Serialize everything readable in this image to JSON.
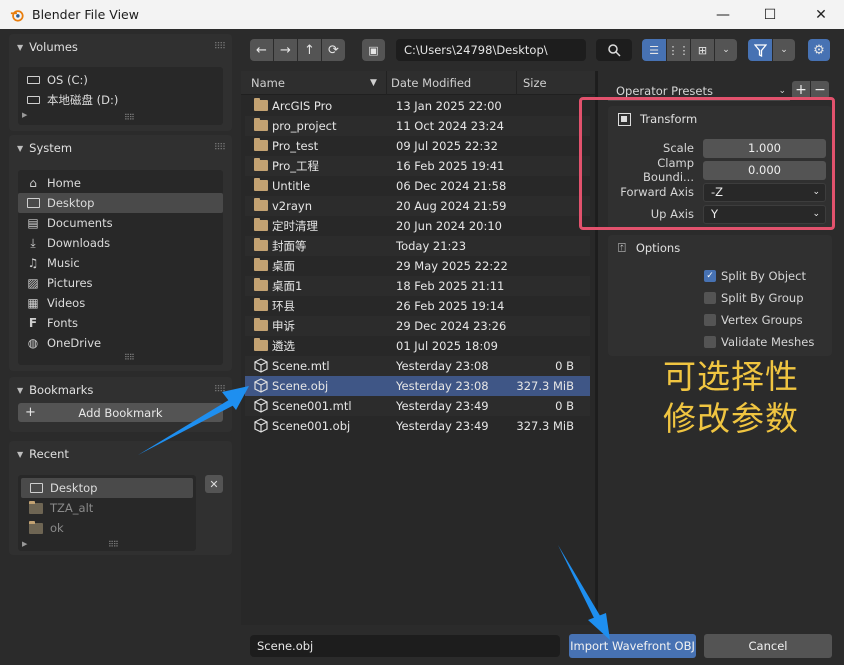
{
  "window": {
    "title": "Blender File View",
    "min": "—",
    "max": "☐",
    "close": "✕"
  },
  "volumes": {
    "title": "Volumes",
    "items": [
      {
        "label": "OS (C:)"
      },
      {
        "label": "本地磁盘 (D:)"
      }
    ]
  },
  "system": {
    "title": "System",
    "items": [
      {
        "label": "Home",
        "icon": "home-icon"
      },
      {
        "label": "Desktop",
        "icon": "desktop-icon",
        "selected": true
      },
      {
        "label": "Documents",
        "icon": "documents-icon"
      },
      {
        "label": "Downloads",
        "icon": "downloads-icon"
      },
      {
        "label": "Music",
        "icon": "music-icon"
      },
      {
        "label": "Pictures",
        "icon": "pictures-icon"
      },
      {
        "label": "Videos",
        "icon": "videos-icon"
      },
      {
        "label": "Fonts",
        "icon": "fonts-icon"
      },
      {
        "label": "OneDrive",
        "icon": "onedrive-icon"
      }
    ]
  },
  "bookmarks": {
    "title": "Bookmarks",
    "add_label": "Add Bookmark"
  },
  "recent": {
    "title": "Recent",
    "items": [
      {
        "label": "Desktop"
      },
      {
        "label": "TZA_alt"
      },
      {
        "label": "ok"
      }
    ]
  },
  "toolbar": {
    "path": "C:\\Users\\24798\\Desktop\\"
  },
  "file_list": {
    "headers": {
      "name": "Name",
      "date": "Date Modified",
      "size": "Size"
    },
    "rows": [
      {
        "name": "ArcGIS Pro",
        "date": "13 Jan 2025 22:00",
        "size": "",
        "type": "folder"
      },
      {
        "name": "pro_project",
        "date": "11 Oct 2024 23:24",
        "size": "",
        "type": "folder"
      },
      {
        "name": "Pro_test",
        "date": "09 Jul 2025 22:32",
        "size": "",
        "type": "folder"
      },
      {
        "name": "Pro_工程",
        "date": "16 Feb 2025 19:41",
        "size": "",
        "type": "folder"
      },
      {
        "name": "Untitle",
        "date": "06 Dec 2024 21:58",
        "size": "",
        "type": "folder"
      },
      {
        "name": "v2rayn",
        "date": "20 Aug 2024 21:59",
        "size": "",
        "type": "folder"
      },
      {
        "name": "定时清理",
        "date": "20 Jun 2024 20:10",
        "size": "",
        "type": "folder"
      },
      {
        "name": "封面等",
        "date": "Today 21:23",
        "size": "",
        "type": "folder"
      },
      {
        "name": "桌面",
        "date": "29 May 2025 22:22",
        "size": "",
        "type": "folder"
      },
      {
        "name": "桌面1",
        "date": "18 Feb 2025 21:11",
        "size": "",
        "type": "folder"
      },
      {
        "name": "环县",
        "date": "26 Feb 2025 19:14",
        "size": "",
        "type": "folder"
      },
      {
        "name": "申诉",
        "date": "29 Dec 2024 23:26",
        "size": "",
        "type": "folder"
      },
      {
        "name": "遴选",
        "date": "01 Jul 2025 18:09",
        "size": "",
        "type": "folder"
      },
      {
        "name": "Scene.mtl",
        "date": "Yesterday 23:08",
        "size": "0 B",
        "type": "file"
      },
      {
        "name": "Scene.obj",
        "date": "Yesterday 23:08",
        "size": "327.3 MiB",
        "type": "file",
        "selected": true
      },
      {
        "name": "Scene001.mtl",
        "date": "Yesterday 23:49",
        "size": "0 B",
        "type": "file"
      },
      {
        "name": "Scene001.obj",
        "date": "Yesterday 23:49",
        "size": "327.3 MiB",
        "type": "file"
      }
    ]
  },
  "operator": {
    "presets_label": "Operator Presets",
    "add": "+",
    "remove": "−"
  },
  "transform": {
    "title": "Transform",
    "scale_label": "Scale",
    "scale_value": "1.000",
    "clamp_label": "Clamp Boundi...",
    "clamp_value": "0.000",
    "forward_label": "Forward Axis",
    "forward_value": "-Z",
    "up_label": "Up Axis",
    "up_value": "Y"
  },
  "options": {
    "title": "Options",
    "items": [
      {
        "label": "Split By Object",
        "checked": true
      },
      {
        "label": "Split By Group",
        "checked": false
      },
      {
        "label": "Vertex Groups",
        "checked": false
      },
      {
        "label": "Validate Meshes",
        "checked": false
      }
    ]
  },
  "bottom": {
    "filename": "Scene.obj",
    "import_label": "Import Wavefront OBJ",
    "cancel_label": "Cancel"
  },
  "annotation": {
    "line1": "可选择性",
    "line2": "修改参数"
  },
  "colors": {
    "accent": "#4772b3",
    "selected_row": "#3f5686",
    "highlight_box": "#e2526d",
    "annotation": "#f0c541",
    "arrow": "#1e8ff0"
  }
}
